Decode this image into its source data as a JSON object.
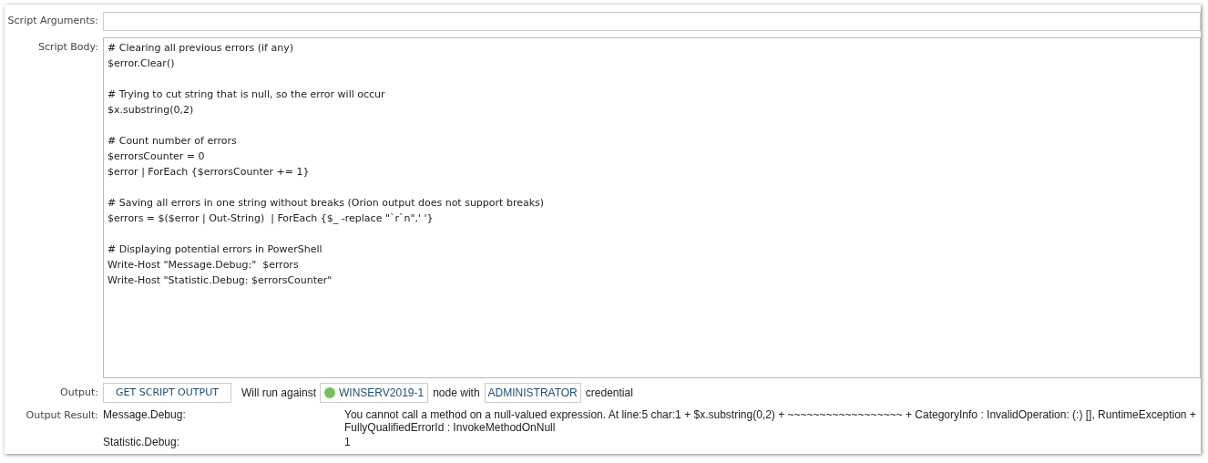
{
  "script_arguments": {
    "label": "Script Arguments:"
  },
  "script_body": {
    "label": "Script Body:",
    "code": "# Clearing all previous errors (if any)\n$error.Clear()\n\n# Trying to cut string that is null, so the error will occur\n$x.substring(0,2)\n\n# Count number of errors\n$errorsCounter = 0\n$error | ForEach {$errorsCounter += 1}\n\n# Saving all errors in one string without breaks (Orion output does not support breaks)\n$errors = $($error | Out-String)  | ForEach {$_ -replace \"`r`n\",' '}\n\n# Displaying potential errors in PowerShell\nWrite-Host \"Message.Debug:\"  $errors\nWrite-Host \"Statistic.Debug: $errorsCounter\""
  },
  "output": {
    "label": "Output:",
    "button": "GET SCRIPT OUTPUT",
    "text_before": "Will run against",
    "node": {
      "name": "WINSERV2019-1",
      "online": true
    },
    "text_middle": "node with",
    "credential": "ADMINISTRATOR",
    "text_after": "credential"
  },
  "output_result": {
    "label": "Output Result:",
    "rows": [
      {
        "name": "Message.Debug:",
        "value": "You cannot call a method on a null-valued expression. At line:5 char:1 + $x.substring(0,2) + ~~~~~~~~~~~~~~~~~~ + CategoryInfo : InvalidOperation: (:) [], RuntimeException + FullyQualifiedErrorId : InvokeMethodOnNull"
      },
      {
        "name": "Statistic.Debug:",
        "value": "1"
      }
    ]
  }
}
